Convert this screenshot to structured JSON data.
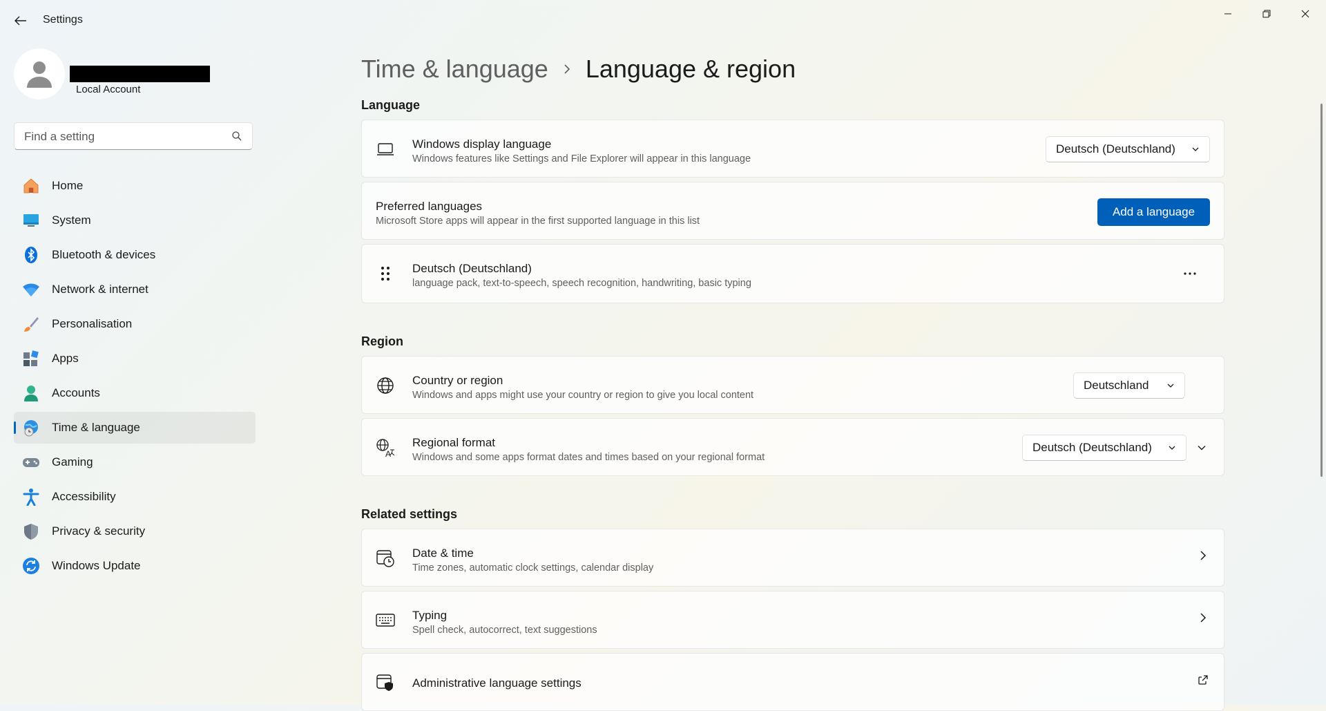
{
  "app": {
    "title": "Settings",
    "account_type": "Local Account"
  },
  "search": {
    "placeholder": "Find a setting"
  },
  "sidebar": {
    "items": [
      {
        "label": "Home",
        "icon": "home-icon"
      },
      {
        "label": "System",
        "icon": "system-icon"
      },
      {
        "label": "Bluetooth & devices",
        "icon": "bluetooth-icon"
      },
      {
        "label": "Network & internet",
        "icon": "wifi-icon"
      },
      {
        "label": "Personalisation",
        "icon": "brush-icon"
      },
      {
        "label": "Apps",
        "icon": "apps-icon"
      },
      {
        "label": "Accounts",
        "icon": "accounts-icon"
      },
      {
        "label": "Time & language",
        "icon": "globe-clock-icon",
        "active": true
      },
      {
        "label": "Gaming",
        "icon": "gamepad-icon"
      },
      {
        "label": "Accessibility",
        "icon": "accessibility-icon"
      },
      {
        "label": "Privacy & security",
        "icon": "shield-icon"
      },
      {
        "label": "Windows Update",
        "icon": "update-icon"
      }
    ]
  },
  "breadcrumb": {
    "parent": "Time & language",
    "current": "Language & region"
  },
  "language_section": {
    "title": "Language",
    "display_language": {
      "title": "Windows display language",
      "subtitle": "Windows features like Settings and File Explorer will appear in this language",
      "value": "Deutsch (Deutschland)"
    },
    "preferred": {
      "title": "Preferred languages",
      "subtitle": "Microsoft Store apps will appear in the first supported language in this list",
      "button": "Add a language"
    },
    "installed": {
      "title": "Deutsch (Deutschland)",
      "subtitle": "language pack, text-to-speech, speech recognition, handwriting, basic typing"
    }
  },
  "region_section": {
    "title": "Region",
    "country": {
      "title": "Country or region",
      "subtitle": "Windows and apps might use your country or region to give you local content",
      "value": "Deutschland"
    },
    "format": {
      "title": "Regional format",
      "subtitle": "Windows and some apps format dates and times based on your regional format",
      "value": "Deutsch (Deutschland)"
    }
  },
  "related_section": {
    "title": "Related settings",
    "date_time": {
      "title": "Date & time",
      "subtitle": "Time zones, automatic clock settings, calendar display"
    },
    "typing": {
      "title": "Typing",
      "subtitle": "Spell check, autocorrect, text suggestions"
    },
    "admin": {
      "title": "Administrative language settings"
    }
  },
  "colors": {
    "accent": "#005fb8",
    "nav_indicator": "#0067c0"
  }
}
